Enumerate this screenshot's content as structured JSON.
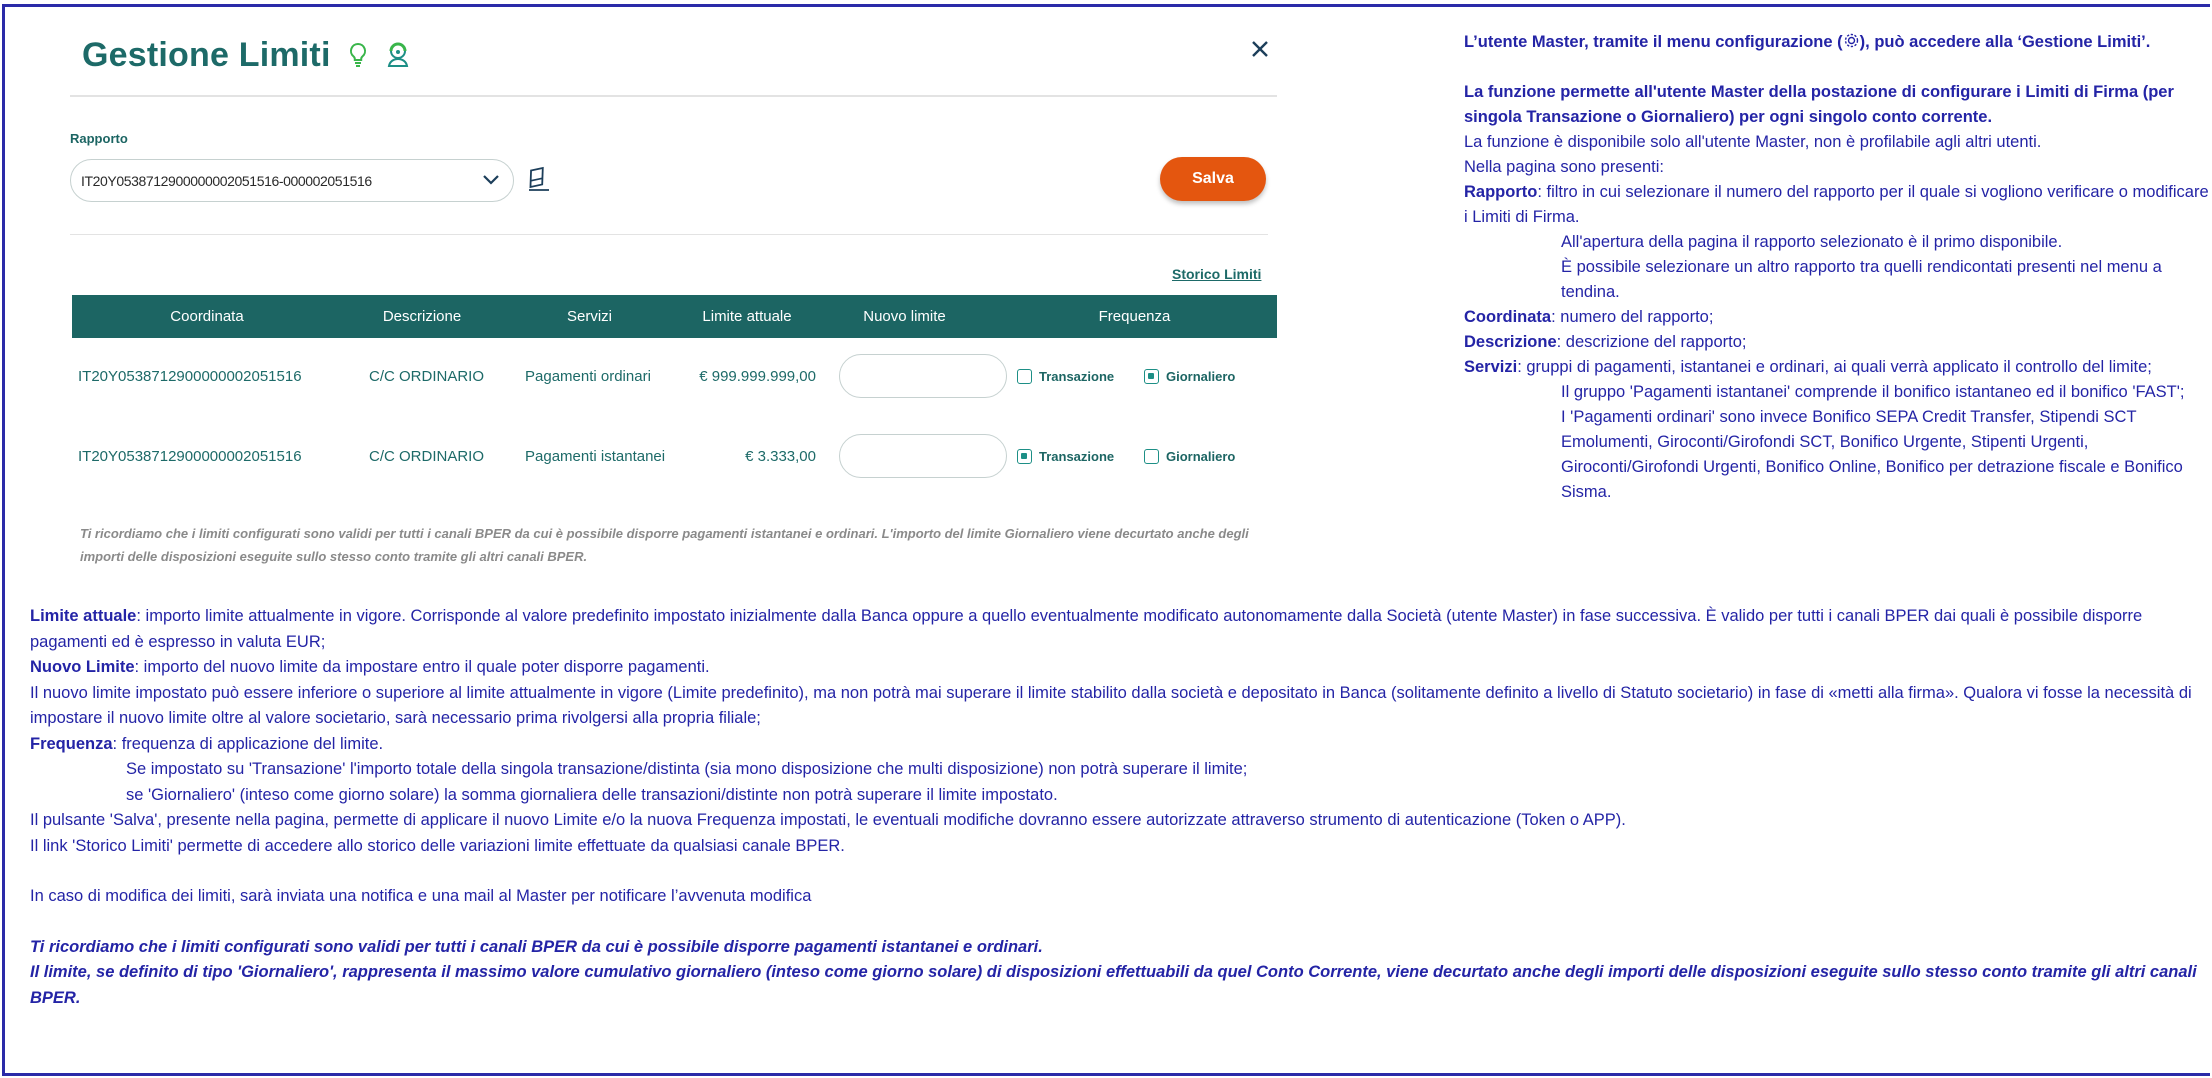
{
  "app": {
    "title": "Gestione Limiti",
    "rapporto_label": "Rapporto",
    "rapporto_selected": "IT20Y0538712900000002051516-000002051516",
    "salva_label": "Salva",
    "storico_label": "Storico Limiti",
    "table": {
      "headers": [
        "Coordinata",
        "Descrizione",
        "Servizi",
        "Limite attuale",
        "Nuovo limite",
        "Frequenza"
      ],
      "rows": [
        {
          "coordinata": "IT20Y0538712900000002051516",
          "descrizione": "C/C ORDINARIO",
          "servizi": "Pagamenti ordinari",
          "limite_attuale": "€ 999.999.999,00",
          "nuovo_limite": "",
          "freq_transazione": "Transazione",
          "freq_giornaliero": "Giornaliero",
          "selected": "Giornaliero"
        },
        {
          "coordinata": "IT20Y0538712900000002051516",
          "descrizione": "C/C ORDINARIO",
          "servizi": "Pagamenti istantanei",
          "limite_attuale": "€ 3.333,00",
          "nuovo_limite": "",
          "freq_transazione": "Transazione",
          "freq_giornaliero": "Giornaliero",
          "selected": "Transazione"
        }
      ]
    },
    "note": "Ti ricordiamo che i limiti configurati sono validi per tutti i canali BPER da cui è possibile disporre pagamenti istantanei e ordinari. L'importo del limite Giornaliero viene decurtato anche degli importi delle disposizioni eseguite sullo stesso conto tramite gli altri canali BPER.",
    "colors": {
      "primary": "#1c6563",
      "accent": "#e4560f",
      "annotation": "#2424a6"
    },
    "icons": [
      "bulb-icon",
      "support-icon",
      "close-icon",
      "chevron-down-icon",
      "eraser-icon",
      "gear-icon"
    ]
  },
  "right": {
    "intro_a": "L’utente Master, tramite il menu configurazione (",
    "intro_b": "), può accedere alla ‘Gestione Limiti’.",
    "func_bold": "La funzione permette all'utente Master della postazione di configurare i Limiti di Firma (per singola Transazione o Giornaliero) per ogni singolo conto corrente.",
    "func_1": "La funzione è disponibile solo all'utente Master, non è profilabile agli altri utenti.",
    "func_2": "Nella pagina sono presenti:",
    "rapporto_term": "Rapporto",
    "rapporto_desc": ": filtro in cui selezionare il numero del rapporto per il quale si vogliono verificare o modificare i Limiti di Firma.",
    "rapporto_i1": "All'apertura della pagina il rapporto selezionato è il primo disponibile.",
    "rapporto_i2": "È possibile selezionare un altro rapporto tra quelli rendicontati presenti nel menu a tendina.",
    "coord_term": "Coordinata",
    "coord_desc": ": numero del rapporto;",
    "descr_term": "Descrizione",
    "descr_desc": ": descrizione del rapporto;",
    "servizi_term": "Servizi",
    "servizi_desc": ": gruppi di pagamenti, istantanei e ordinari, ai quali verrà applicato il controllo del limite;",
    "servizi_i1": "Il gruppo 'Pagamenti istantanei' comprende il bonifico istantaneo ed il bonifico 'FAST';",
    "servizi_i2": "I 'Pagamenti ordinari' sono invece Bonifico SEPA Credit Transfer, Stipendi SCT Emolumenti, Giroconti/Girofondi SCT, Bonifico Urgente, Stipenti Urgenti, Giroconti/Girofondi Urgenti, Bonifico Online, Bonifico per detrazione fiscale e Bonifico Sisma."
  },
  "bottom": {
    "limite_term": "Limite attuale",
    "limite_desc": ": importo limite attualmente in vigore. Corrisponde al valore predefinito impostato inizialmente dalla Banca oppure a quello eventualmente modificato autonomamente dalla Società (utente Master) in fase successiva. È valido per tutti i canali BPER dai quali è possibile disporre pagamenti ed è espresso in valuta EUR;",
    "nuovo_term": "Nuovo Limite",
    "nuovo_desc": ": importo del nuovo limite da impostare entro il quale poter disporre pagamenti.",
    "nuovo_p": "Il nuovo limite impostato può essere inferiore o superiore al limite attualmente in vigore (Limite predefinito), ma non potrà mai superare il limite stabilito dalla società e depositato in Banca (solitamente definito a livello di Statuto societario) in fase di «metti alla firma». Qualora vi fosse la necessità di impostare il nuovo limite oltre al valore societario, sarà necessario prima rivolgersi alla propria filiale;",
    "freq_term": "Frequenza",
    "freq_desc": ": frequenza di applicazione del limite.",
    "freq_i1": "Se impostato su 'Transazione' l'importo totale della singola transazione/distinta (sia mono disposizione che multi disposizione) non potrà superare il limite;",
    "freq_i2": "se 'Giornaliero' (inteso come giorno solare) la somma giornaliera delle transazioni/distinte non potrà superare il limite impostato.",
    "salva_p": "Il pulsante 'Salva', presente nella pagina, permette di applicare il nuovo Limite e/o la nuova Frequenza impostati, le eventuali modifiche dovranno essere autorizzate attraverso strumento di autenticazione (Token o APP).",
    "storico_p": "Il link 'Storico Limiti' permette di accedere allo storico delle variazioni limite effettuate da qualsiasi canale BPER.",
    "notifica_p": "In caso di modifica dei limiti, sarà inviata una notifica e una mail al Master per notificare l’avvenuta modifica",
    "em1": "Ti ricordiamo che i limiti configurati sono validi per tutti i canali BPER da cui è possibile disporre pagamenti istantanei e ordinari.",
    "em2": "Il limite, se definito di tipo 'Giornaliero', rappresenta il massimo valore cumulativo giornaliero (inteso come giorno solare) di disposizioni effettuabili da quel Conto Corrente, viene decurtato anche degli importi delle disposizioni eseguite sullo stesso conto tramite gli altri canali BPER."
  }
}
